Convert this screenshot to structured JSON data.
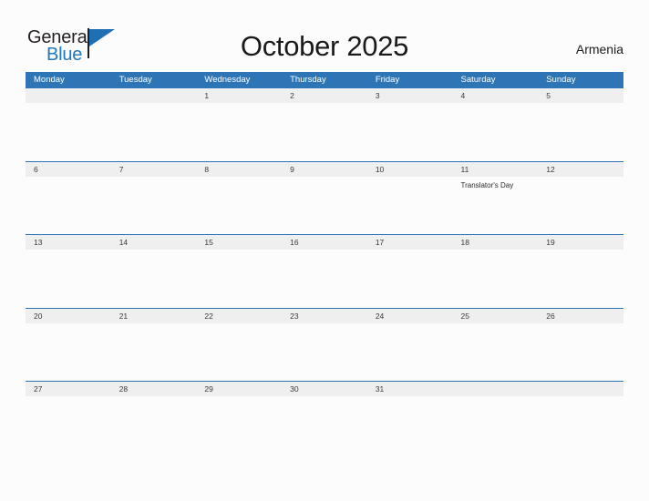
{
  "logo": {
    "word_top": "General",
    "word_bottom": "Blue",
    "flag_icon": "blue-triangle-flag-icon",
    "accent_color": "#1f77bc"
  },
  "header": {
    "title": "October 2025",
    "region": "Armenia"
  },
  "colors": {
    "header_blue": "#2e75b6",
    "date_band_grey": "#efefef",
    "page_background": "#fcfcfd",
    "logo_blue": "#1f77bc"
  },
  "calendar": {
    "month": "October",
    "year": "2025",
    "weekday_headers": [
      "Monday",
      "Tuesday",
      "Wednesday",
      "Thursday",
      "Friday",
      "Saturday",
      "Sunday"
    ],
    "weeks": [
      {
        "days": [
          {
            "date": "",
            "events": []
          },
          {
            "date": "",
            "events": []
          },
          {
            "date": "1",
            "events": []
          },
          {
            "date": "2",
            "events": []
          },
          {
            "date": "3",
            "events": []
          },
          {
            "date": "4",
            "events": []
          },
          {
            "date": "5",
            "events": []
          }
        ]
      },
      {
        "days": [
          {
            "date": "6",
            "events": []
          },
          {
            "date": "7",
            "events": []
          },
          {
            "date": "8",
            "events": []
          },
          {
            "date": "9",
            "events": []
          },
          {
            "date": "10",
            "events": []
          },
          {
            "date": "11",
            "events": [
              "Translator's Day"
            ]
          },
          {
            "date": "12",
            "events": []
          }
        ]
      },
      {
        "days": [
          {
            "date": "13",
            "events": []
          },
          {
            "date": "14",
            "events": []
          },
          {
            "date": "15",
            "events": []
          },
          {
            "date": "16",
            "events": []
          },
          {
            "date": "17",
            "events": []
          },
          {
            "date": "18",
            "events": []
          },
          {
            "date": "19",
            "events": []
          }
        ]
      },
      {
        "days": [
          {
            "date": "20",
            "events": []
          },
          {
            "date": "21",
            "events": []
          },
          {
            "date": "22",
            "events": []
          },
          {
            "date": "23",
            "events": []
          },
          {
            "date": "24",
            "events": []
          },
          {
            "date": "25",
            "events": []
          },
          {
            "date": "26",
            "events": []
          }
        ]
      },
      {
        "days": [
          {
            "date": "27",
            "events": []
          },
          {
            "date": "28",
            "events": []
          },
          {
            "date": "29",
            "events": []
          },
          {
            "date": "30",
            "events": []
          },
          {
            "date": "31",
            "events": []
          },
          {
            "date": "",
            "events": []
          },
          {
            "date": "",
            "events": []
          }
        ]
      }
    ]
  }
}
